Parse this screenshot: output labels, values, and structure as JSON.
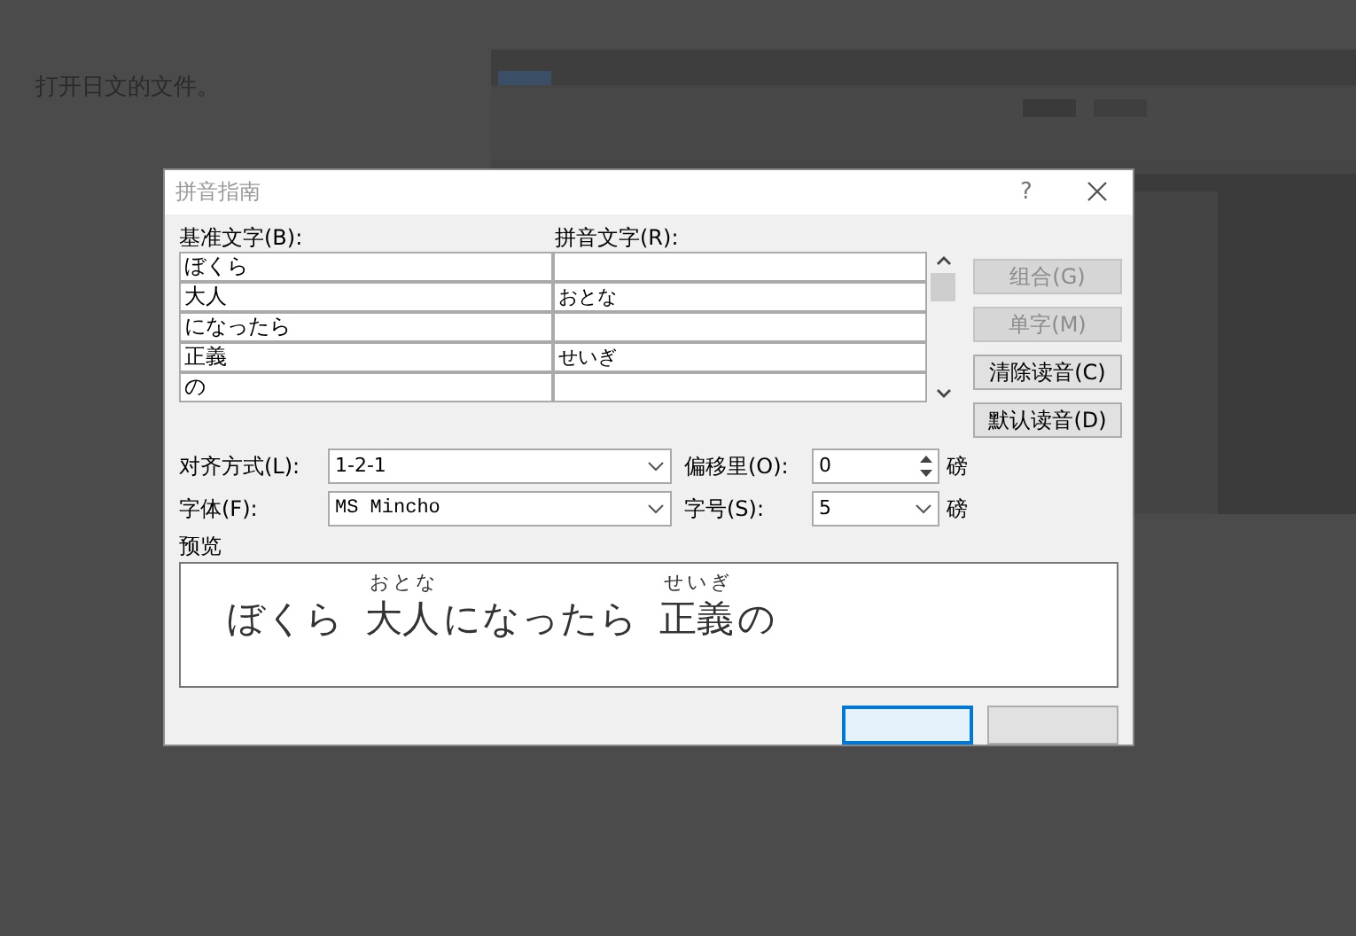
{
  "background": {
    "text": "打开日文的文件。"
  },
  "window": {
    "title": "拼音指南",
    "help": "?"
  },
  "columns": [
    "基准文字(B):",
    "拼音文字(R):"
  ],
  "rows": [
    {
      "base": "ぼくら"
    },
    {
      "base": "大人",
      "ruby": "おとな"
    },
    {
      "base": "になったら"
    },
    {
      "base": "正義",
      "ruby": "せいぎ"
    },
    {
      "base": "の"
    }
  ],
  "side_buttons": [
    {
      "label": "组合(G)",
      "disabled": true
    },
    {
      "label": "单字(M)",
      "disabled": true
    },
    {
      "label": "清除读音(C)",
      "disabled": false
    },
    {
      "label": "默认读音(D)",
      "disabled": false
    }
  ],
  "alignment": {
    "label": "对齐方式(L):",
    "value": "1-2-1"
  },
  "offset": {
    "label": "偏移里(O):",
    "value": "0",
    "unit": "磅"
  },
  "font": {
    "label": "字体(F):",
    "value": "MS Mincho"
  },
  "size": {
    "label": "字号(S):",
    "value": "5",
    "unit": "磅"
  },
  "preview": {
    "label": "预览",
    "segments": [
      {
        "text": "ぼくら"
      },
      {
        "text": "大人",
        "ruby": "おとな"
      },
      {
        "text": "になったら"
      },
      {
        "text": "正義",
        "ruby": "せいぎ"
      },
      {
        "text": "の"
      }
    ]
  },
  "footer_buttons": [
    {
      "default": true
    },
    {
      "default": false
    }
  ]
}
